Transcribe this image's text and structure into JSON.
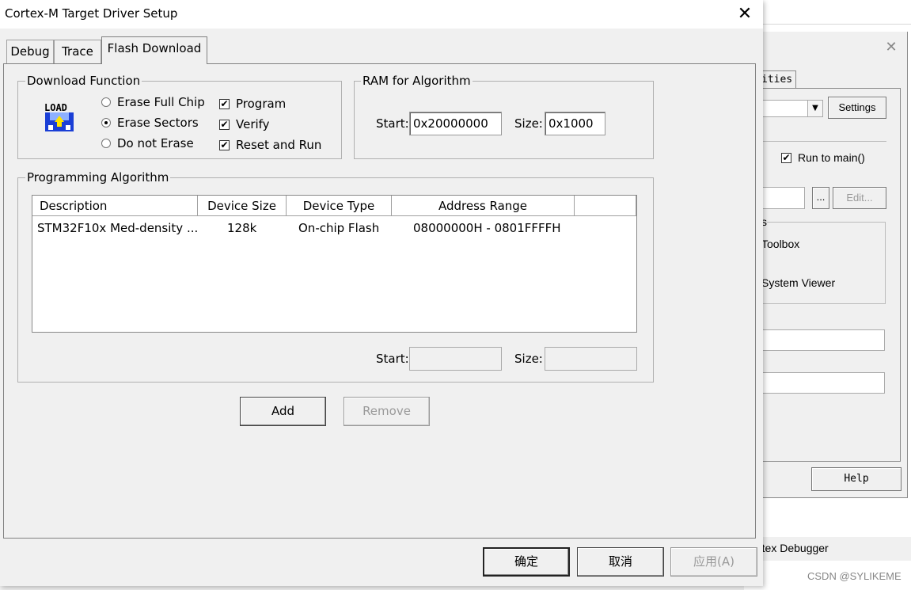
{
  "background_window": {
    "tab_fragment": "ities",
    "settings_label": "Settings",
    "run_to_main_label": "Run to main()",
    "run_to_main_checked": true,
    "edit_label": "Edit...",
    "browse_label": "...",
    "group_fragment": "s",
    "toolbox_label": "Toolbox",
    "system_viewer_label": "System Viewer",
    "help_label": "Help",
    "status_text": "rtex Debugger",
    "watermark": "CSDN @SYLIKEME"
  },
  "dialog": {
    "title": "Cortex-M Target Driver Setup",
    "close_glyph": "✕",
    "tabs": [
      {
        "label": "Debug",
        "active": false
      },
      {
        "label": "Trace",
        "active": false
      },
      {
        "label": "Flash Download",
        "active": true
      }
    ],
    "download_function": {
      "label": "Download Function",
      "radios": [
        {
          "label": "Erase Full Chip",
          "selected": false
        },
        {
          "label": "Erase Sectors",
          "selected": true
        },
        {
          "label": "Do not Erase",
          "selected": false
        }
      ],
      "checks": [
        {
          "label": "Program",
          "checked": true
        },
        {
          "label": "Verify",
          "checked": true
        },
        {
          "label": "Reset and Run",
          "checked": true
        }
      ],
      "icon": "load-icon",
      "icon_text": "LOAD"
    },
    "ram": {
      "label": "RAM for Algorithm",
      "start_label": "Start:",
      "start_value": "0x20000000",
      "size_label": "Size:",
      "size_value": "0x1000"
    },
    "programming": {
      "label": "Programming Algorithm",
      "columns": [
        "Description",
        "Device Size",
        "Device Type",
        "Address Range"
      ],
      "rows": [
        {
          "description": "STM32F10x Med-density ...",
          "size": "128k",
          "type": "On-chip Flash",
          "range": "08000000H - 0801FFFFH"
        }
      ],
      "start_label": "Start:",
      "start_value": "",
      "size_label": "Size:",
      "size_value": ""
    },
    "add_label": "Add",
    "remove_label": "Remove",
    "ok_label": "确定",
    "cancel_label": "取消",
    "apply_label": "应用(A)"
  }
}
